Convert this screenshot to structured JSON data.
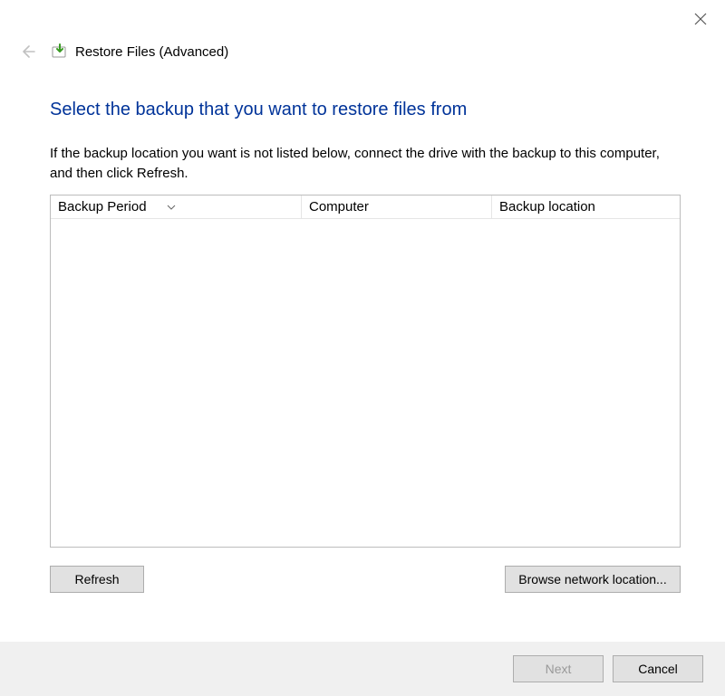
{
  "window": {
    "wizard_title": "Restore Files (Advanced)"
  },
  "main": {
    "heading": "Select the backup that you want to restore files from",
    "instructions": "If the backup location you want is not listed below, connect the drive with the backup to this computer, and then click Refresh."
  },
  "table": {
    "columns": [
      "Backup Period",
      "Computer",
      "Backup location"
    ],
    "rows": []
  },
  "actions": {
    "refresh_label": "Refresh",
    "browse_label": "Browse network location..."
  },
  "footer": {
    "next_label": "Next",
    "cancel_label": "Cancel"
  }
}
